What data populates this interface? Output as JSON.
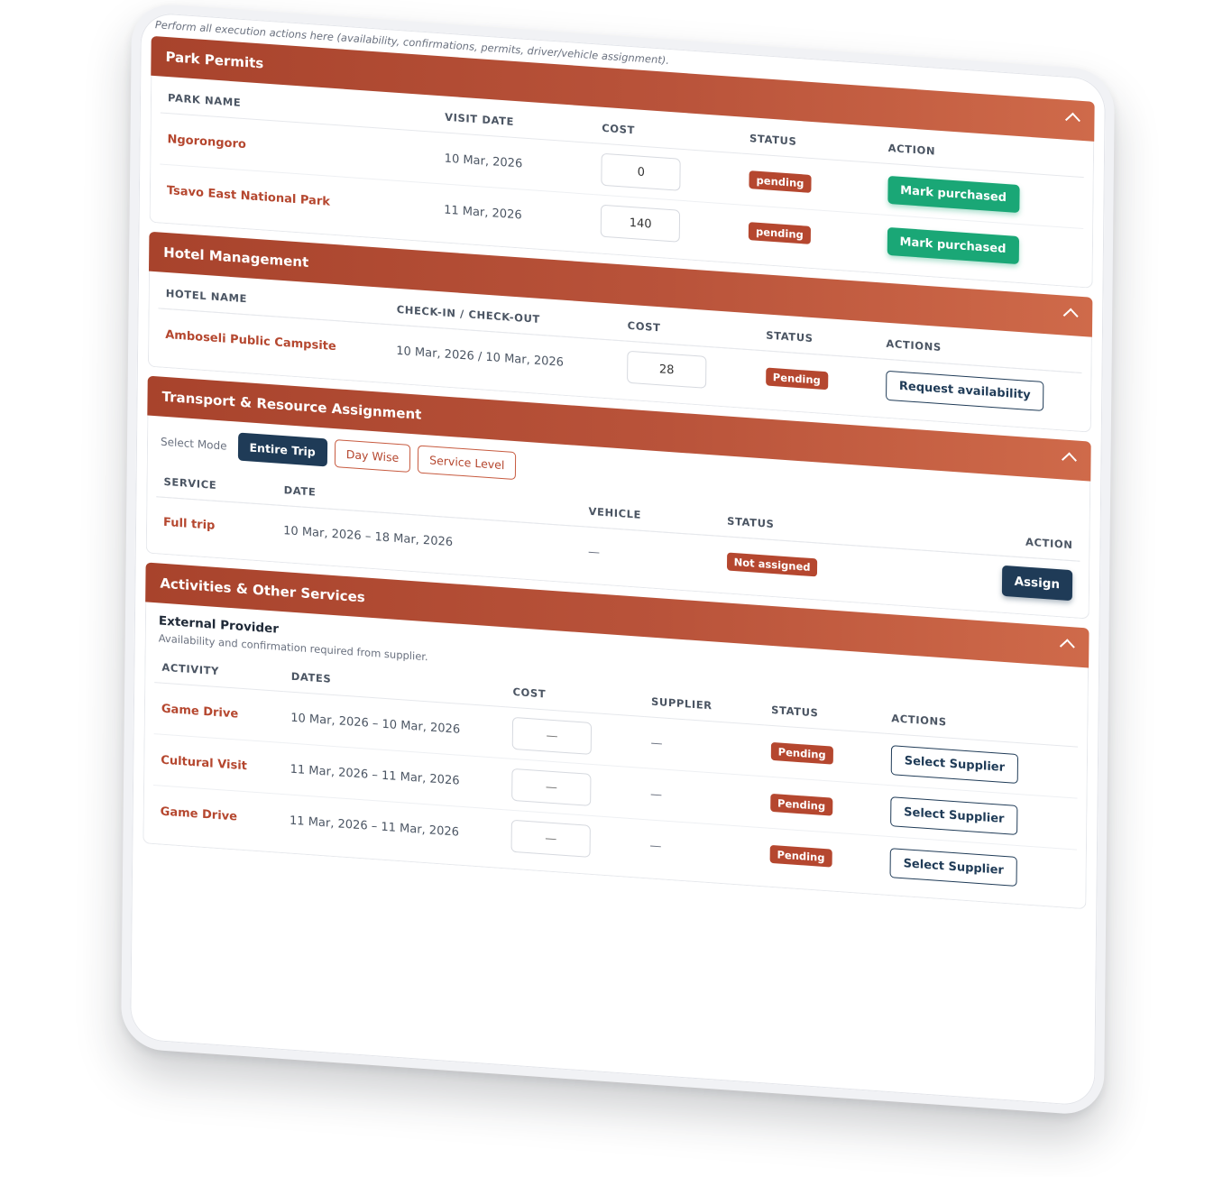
{
  "intro": "Perform all execution actions here (availability, confirmations, permits, driver/vehicle assignment).",
  "park_permits": {
    "title": "Park Permits",
    "columns": [
      "PARK NAME",
      "VISIT DATE",
      "COST",
      "STATUS",
      "ACTION"
    ],
    "rows": [
      {
        "name": "Ngorongoro",
        "date": "10 Mar, 2026",
        "cost": "0",
        "status": "pending",
        "action": "Mark purchased"
      },
      {
        "name": "Tsavo East National Park",
        "date": "11 Mar, 2026",
        "cost": "140",
        "status": "pending",
        "action": "Mark purchased"
      }
    ]
  },
  "hotel": {
    "title": "Hotel Management",
    "columns": [
      "HOTEL NAME",
      "CHECK-IN / CHECK-OUT",
      "COST",
      "STATUS",
      "ACTIONS"
    ],
    "rows": [
      {
        "name": "Amboseli Public Campsite",
        "dates": "10 Mar, 2026 / 10 Mar, 2026",
        "cost": "28",
        "status": "Pending",
        "action": "Request availability"
      }
    ]
  },
  "transport": {
    "title": "Transport & Resource Assignment",
    "mode_label": "Select Mode",
    "modes": [
      "Entire Trip",
      "Day Wise",
      "Service Level"
    ],
    "columns": [
      "SERVICE",
      "DATE",
      "VEHICLE",
      "STATUS",
      "ACTION"
    ],
    "rows": [
      {
        "service": "Full trip",
        "date": "10 Mar, 2026 – 18 Mar, 2026",
        "vehicle": "—",
        "status": "Not assigned",
        "action": "Assign"
      }
    ]
  },
  "activities": {
    "title": "Activities & Other Services",
    "subtitle": "External Provider",
    "note": "Availability and confirmation required from supplier.",
    "columns": [
      "ACTIVITY",
      "DATES",
      "COST",
      "SUPPLIER",
      "STATUS",
      "ACTIONS"
    ],
    "rows": [
      {
        "name": "Game Drive",
        "dates": "10 Mar, 2026 – 10 Mar, 2026",
        "cost_placeholder": "—",
        "supplier": "—",
        "status": "Pending",
        "action": "Select Supplier"
      },
      {
        "name": "Cultural Visit",
        "dates": "11 Mar, 2026 – 11 Mar, 2026",
        "cost_placeholder": "—",
        "supplier": "—",
        "status": "Pending",
        "action": "Select Supplier"
      },
      {
        "name": "Game Drive",
        "dates": "11 Mar, 2026 – 11 Mar, 2026",
        "cost_placeholder": "—",
        "supplier": "—",
        "status": "Pending",
        "action": "Select Supplier"
      }
    ]
  },
  "colors": {
    "section_header": "#b5472f",
    "primary_navy": "#1f3b57",
    "success_green": "#1aa776"
  }
}
